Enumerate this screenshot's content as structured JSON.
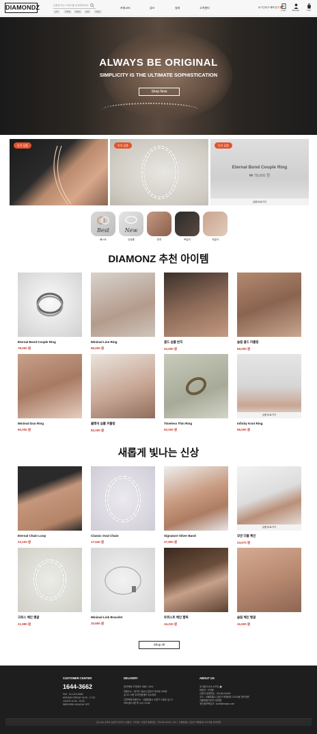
{
  "header": {
    "logo": "DIAMONDZ",
    "search_placeholder": "상품명 또는 브랜드를 검색해보세요",
    "keywords": [
      "반지",
      "커플링",
      "목걸이",
      "팔찌",
      "귀걸이"
    ],
    "nav": [
      "카테고리",
      "글쓰",
      "실버",
      "고객센터"
    ],
    "login_note": "로그인하고 혜택 받기 🎁",
    "icons": [
      {
        "name": "login-icon",
        "label": "Login"
      },
      {
        "name": "user-icon",
        "label": "Mypage"
      },
      {
        "name": "cart-icon",
        "label": "Cart"
      }
    ]
  },
  "hero": {
    "title": "ALWAYS BE ORIGINAL",
    "subtitle": "SIMPLICITY IS THE ULTIMATE SOPHISTICATION",
    "button": "Shop Now"
  },
  "promos": [
    {
      "badge": "인기 상품"
    },
    {
      "badge": "인기 상품"
    },
    {
      "badge": "인기 상품",
      "title": "Eternal Bond Couple Ring",
      "price": "₩ 78,000 원",
      "caption": "상품 바로가기"
    }
  ],
  "categories": [
    {
      "label": "베스트",
      "word": "Best"
    },
    {
      "label": "신상품",
      "word": "New"
    },
    {
      "label": "반지",
      "word": ""
    },
    {
      "label": "목걸이",
      "word": ""
    },
    {
      "label": "귀걸이",
      "word": ""
    }
  ],
  "recommended": {
    "title": "DIAMONZ 추천 아이템",
    "items": [
      {
        "name": "Eternal Bond Couple Ring",
        "price": "78,000 원"
      },
      {
        "name": "Minimal Line Ring",
        "price": "66,000 원"
      },
      {
        "name": "골드 심플 반지",
        "price": "42,000 원"
      },
      {
        "name": "슬림 골드 커플링",
        "price": "69,000 원"
      },
      {
        "name": "Minimal Duo Ring",
        "price": "60,000 원"
      },
      {
        "name": "클래식 심플 커플링",
        "price": "82,000 원"
      },
      {
        "name": "Timeless Thin Ring",
        "price": "92,000 원"
      },
      {
        "name": "Infinity Knot Ring",
        "price": "68,000 원",
        "caption": "상품 바로가기"
      }
    ]
  },
  "new_arrivals": {
    "title": "새롭게 빛나는 신상",
    "items": [
      {
        "name": "Eternal Chain Loop",
        "price": "23,100 원"
      },
      {
        "name": "Classic Oval Chain",
        "price": "17,640 원"
      },
      {
        "name": "Signature Silver Band",
        "price": "37,900 원"
      },
      {
        "name": "모던 더블 체인",
        "price": "24,570 원",
        "caption": "상품 바로가기"
      },
      {
        "name": "크로스 체인 뱅글",
        "price": "21,990 원"
      },
      {
        "name": "Minimal Link Bracelet",
        "price": "20,650 원"
      },
      {
        "name": "트위스트 체인 팔찌",
        "price": "16,230 원"
      },
      {
        "name": "슬림 체인 뱅글",
        "price": "16,500 원"
      }
    ],
    "show_all": "Shop All"
  },
  "footer": {
    "customer": {
      "head": "CUSTOMER CENTER",
      "phone": "1644-3662",
      "lines": [
        "FAX : 02-1212-8080",
        "MONDAY-FRIDAY 10:00 - 17:00",
        "LUNCH 12:00 - 13:00",
        "WEEKEND.HOLIDAY OFF"
      ]
    },
    "delivery": {
      "head": "DELIVERY",
      "lines": [
        "한진택배 고객센터 1588 - 0011",
        "반품주소 : 경기도 성남시 분당구 판교로 000번",
        "길 00 / 0층 우리반품센터 이소하요",
        "다른택배 반품주소 : 서울특별시 노원구 노원로 길 10",
        "허브센터 3층 목 서서 고고요"
      ]
    },
    "about": {
      "head": "ABOUT US",
      "lines": [
        "주식회사 DIA 소프트 🏠",
        "대표자 : 이지윤",
        "사업자 등록번호 : 224-80-00000",
        "주소 : 서울특별시 강남구 테헤란로 123 B동 전라대변",
        "서울특별 마라이 담연합",
        "개인정보책임자 : scott@masac.com"
      ]
    },
    "copyright": "(주) DIA 소프트 상호약 라이이 / 대표자 : 이지윤 / 사업자 등록번호 : 224-80-00000 / 주소 : 서울특별시 강남구 테헤란로 123 B동 전라대변"
  },
  "colors": {
    "accent": "#e2532b",
    "price": "#c0392b",
    "footer_bg": "#1e1e1e"
  }
}
